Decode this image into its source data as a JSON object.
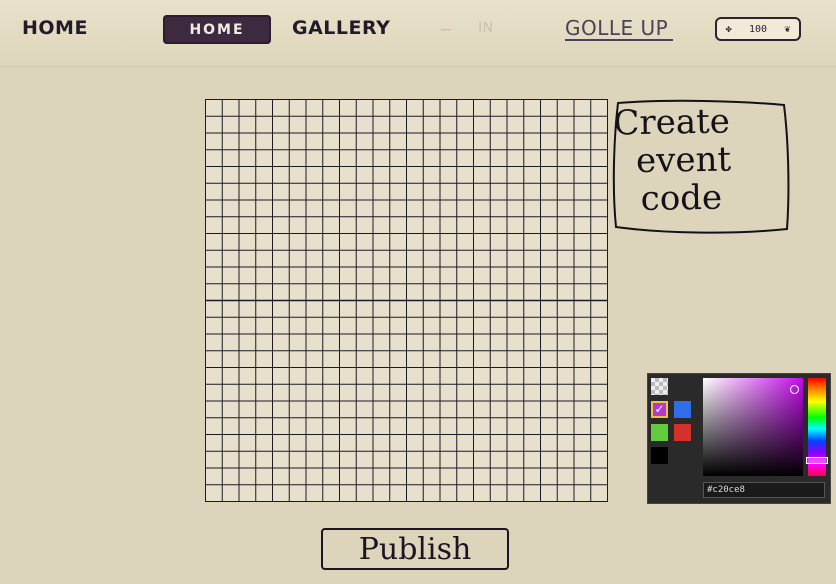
{
  "nav": {
    "home_plain": "HOME",
    "home_active": "HOME",
    "gallery": "GALLERY",
    "faded_a": "—",
    "faded_b": "IN",
    "golle_up": "GOLLE UP"
  },
  "balance": {
    "icon": "✤",
    "amount": "100",
    "icon_right": "❦"
  },
  "grid": {
    "columns": 24,
    "rows": 24,
    "line_color": "#1e1a24"
  },
  "note": {
    "lines": [
      "Create",
      "event",
      "code"
    ]
  },
  "picker": {
    "swatches": [
      {
        "name": "transparent-swatch",
        "color": "transparent"
      },
      {
        "name": "purple-swatch",
        "color": "#b23ad0",
        "selected": true,
        "check": "✓"
      },
      {
        "name": "blue-swatch",
        "color": "#2f6ee8"
      },
      {
        "name": "green-swatch",
        "color": "#62cc3c"
      },
      {
        "name": "red-swatch",
        "color": "#d4302c"
      },
      {
        "name": "black-swatch",
        "color": "#000000"
      }
    ],
    "hex_value": "#c20ce8",
    "current_color": "#c20ce8"
  },
  "publish": {
    "label": "Publish"
  }
}
